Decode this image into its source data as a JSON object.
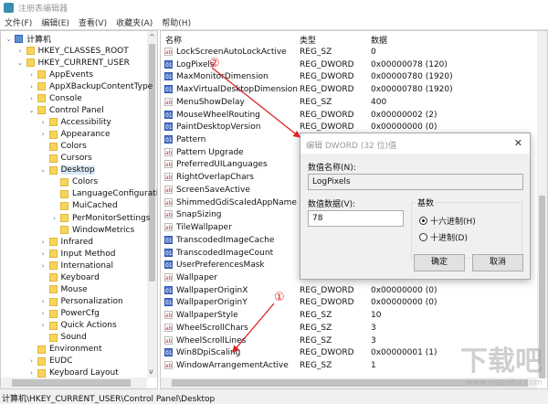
{
  "window": {
    "title": "注册表编辑器",
    "icon": "regedit-icon"
  },
  "menu": [
    "文件(F)",
    "编辑(E)",
    "查看(V)",
    "收藏夹(A)",
    "帮助(H)"
  ],
  "tree": [
    {
      "label": "计算机",
      "level": 0,
      "exp": "v",
      "root": true
    },
    {
      "label": "HKEY_CLASSES_ROOT",
      "level": 1,
      "exp": ">"
    },
    {
      "label": "HKEY_CURRENT_USER",
      "level": 1,
      "exp": "v"
    },
    {
      "label": "AppEvents",
      "level": 2,
      "exp": ">"
    },
    {
      "label": "AppXBackupContentType",
      "level": 2,
      "exp": ">"
    },
    {
      "label": "Console",
      "level": 2,
      "exp": ">"
    },
    {
      "label": "Control Panel",
      "level": 2,
      "exp": "v"
    },
    {
      "label": "Accessibility",
      "level": 3,
      "exp": ">"
    },
    {
      "label": "Appearance",
      "level": 3,
      "exp": ">"
    },
    {
      "label": "Colors",
      "level": 3,
      "exp": ""
    },
    {
      "label": "Cursors",
      "level": 3,
      "exp": ""
    },
    {
      "label": "Desktop",
      "level": 3,
      "exp": "v",
      "selected": true
    },
    {
      "label": "Colors",
      "level": 4,
      "exp": ""
    },
    {
      "label": "LanguageConfiguratio",
      "level": 4,
      "exp": ""
    },
    {
      "label": "MuiCached",
      "level": 4,
      "exp": ""
    },
    {
      "label": "PerMonitorSettings",
      "level": 4,
      "exp": ">"
    },
    {
      "label": "WindowMetrics",
      "level": 4,
      "exp": ""
    },
    {
      "label": "Infrared",
      "level": 3,
      "exp": ">"
    },
    {
      "label": "Input Method",
      "level": 3,
      "exp": ">"
    },
    {
      "label": "International",
      "level": 3,
      "exp": ">"
    },
    {
      "label": "Keyboard",
      "level": 3,
      "exp": ""
    },
    {
      "label": "Mouse",
      "level": 3,
      "exp": ""
    },
    {
      "label": "Personalization",
      "level": 3,
      "exp": ">"
    },
    {
      "label": "PowerCfg",
      "level": 3,
      "exp": ">"
    },
    {
      "label": "Quick Actions",
      "level": 3,
      "exp": ">"
    },
    {
      "label": "Sound",
      "level": 3,
      "exp": ""
    },
    {
      "label": "Environment",
      "level": 2,
      "exp": ""
    },
    {
      "label": "EUDC",
      "level": 2,
      "exp": ">"
    },
    {
      "label": "Keyboard Layout",
      "level": 2,
      "exp": ">"
    }
  ],
  "columns": {
    "name": "名称",
    "type": "类型",
    "data": "数据"
  },
  "values": [
    {
      "name": "LockScreenAutoLockActive",
      "type": "REG_SZ",
      "data": "0",
      "icon": "sz"
    },
    {
      "name": "LogPixels",
      "type": "REG_DWORD",
      "data": "0x00000078 (120)",
      "icon": "dw"
    },
    {
      "name": "MaxMonitorDimension",
      "type": "REG_DWORD",
      "data": "0x00000780 (1920)",
      "icon": "dw"
    },
    {
      "name": "MaxVirtualDesktopDimension",
      "type": "REG_DWORD",
      "data": "0x00000780 (1920)",
      "icon": "dw"
    },
    {
      "name": "MenuShowDelay",
      "type": "REG_SZ",
      "data": "400",
      "icon": "sz"
    },
    {
      "name": "MouseWheelRouting",
      "type": "REG_DWORD",
      "data": "0x00000002 (2)",
      "icon": "dw"
    },
    {
      "name": "PaintDesktopVersion",
      "type": "REG_DWORD",
      "data": "0x00000000 (0)",
      "icon": "dw"
    },
    {
      "name": "Pattern",
      "type": "",
      "data": "",
      "icon": "dw"
    },
    {
      "name": "Pattern Upgrade",
      "type": "",
      "data": "",
      "icon": "sz"
    },
    {
      "name": "PreferredUILanguages",
      "type": "",
      "data": "",
      "icon": "sz"
    },
    {
      "name": "RightOverlapChars",
      "type": "",
      "data": "",
      "icon": "sz"
    },
    {
      "name": "ScreenSaveActive",
      "type": "",
      "data": "",
      "icon": "sz"
    },
    {
      "name": "ShimmedGdiScaledAppName",
      "type": "",
      "data": "",
      "icon": "sz"
    },
    {
      "name": "SnapSizing",
      "type": "",
      "data": "",
      "icon": "sz"
    },
    {
      "name": "TileWallpaper",
      "type": "",
      "data": "",
      "icon": "sz"
    },
    {
      "name": "TranscodedImageCache",
      "type": "",
      "data": "",
      "icon": "dw"
    },
    {
      "name": "TranscodedImageCount",
      "type": "",
      "data": "",
      "icon": "dw"
    },
    {
      "name": "UserPreferencesMask",
      "type": "",
      "data": "",
      "icon": "dw"
    },
    {
      "name": "Wallpaper",
      "type": "",
      "data": "",
      "icon": "sz"
    },
    {
      "name": "WallpaperOriginX",
      "type": "REG_DWORD",
      "data": "0x00000000 (0)",
      "icon": "dw"
    },
    {
      "name": "WallpaperOriginY",
      "type": "REG_DWORD",
      "data": "0x00000000 (0)",
      "icon": "dw"
    },
    {
      "name": "WallpaperStyle",
      "type": "REG_SZ",
      "data": "10",
      "icon": "sz"
    },
    {
      "name": "WheelScrollChars",
      "type": "REG_SZ",
      "data": "3",
      "icon": "sz"
    },
    {
      "name": "WheelScrollLines",
      "type": "REG_SZ",
      "data": "3",
      "icon": "sz"
    },
    {
      "name": "Win8DpiScaling",
      "type": "REG_DWORD",
      "data": "0x00000001 (1)",
      "icon": "dw"
    },
    {
      "name": "WindowArrangementActive",
      "type": "REG_SZ",
      "data": "1",
      "icon": "sz"
    }
  ],
  "status": "计算机\\HKEY_CURRENT_USER\\Control Panel\\Desktop",
  "dialog": {
    "title": "编辑 DWORD (32 位)值",
    "name_label": "数值名称(N):",
    "name_value": "LogPixels",
    "data_label": "数值数据(V):",
    "data_value": "78",
    "base_label": "基数",
    "hex_label": "十六进制(H)",
    "dec_label": "十进制(D)",
    "selected_base": "hex",
    "ok": "确定",
    "cancel": "取消"
  },
  "annotations": {
    "step1": "①",
    "step2": "②",
    "color": "#dd2222"
  },
  "watermark": {
    "text": "下载吧",
    "url": "www.xiazaiba.com"
  }
}
